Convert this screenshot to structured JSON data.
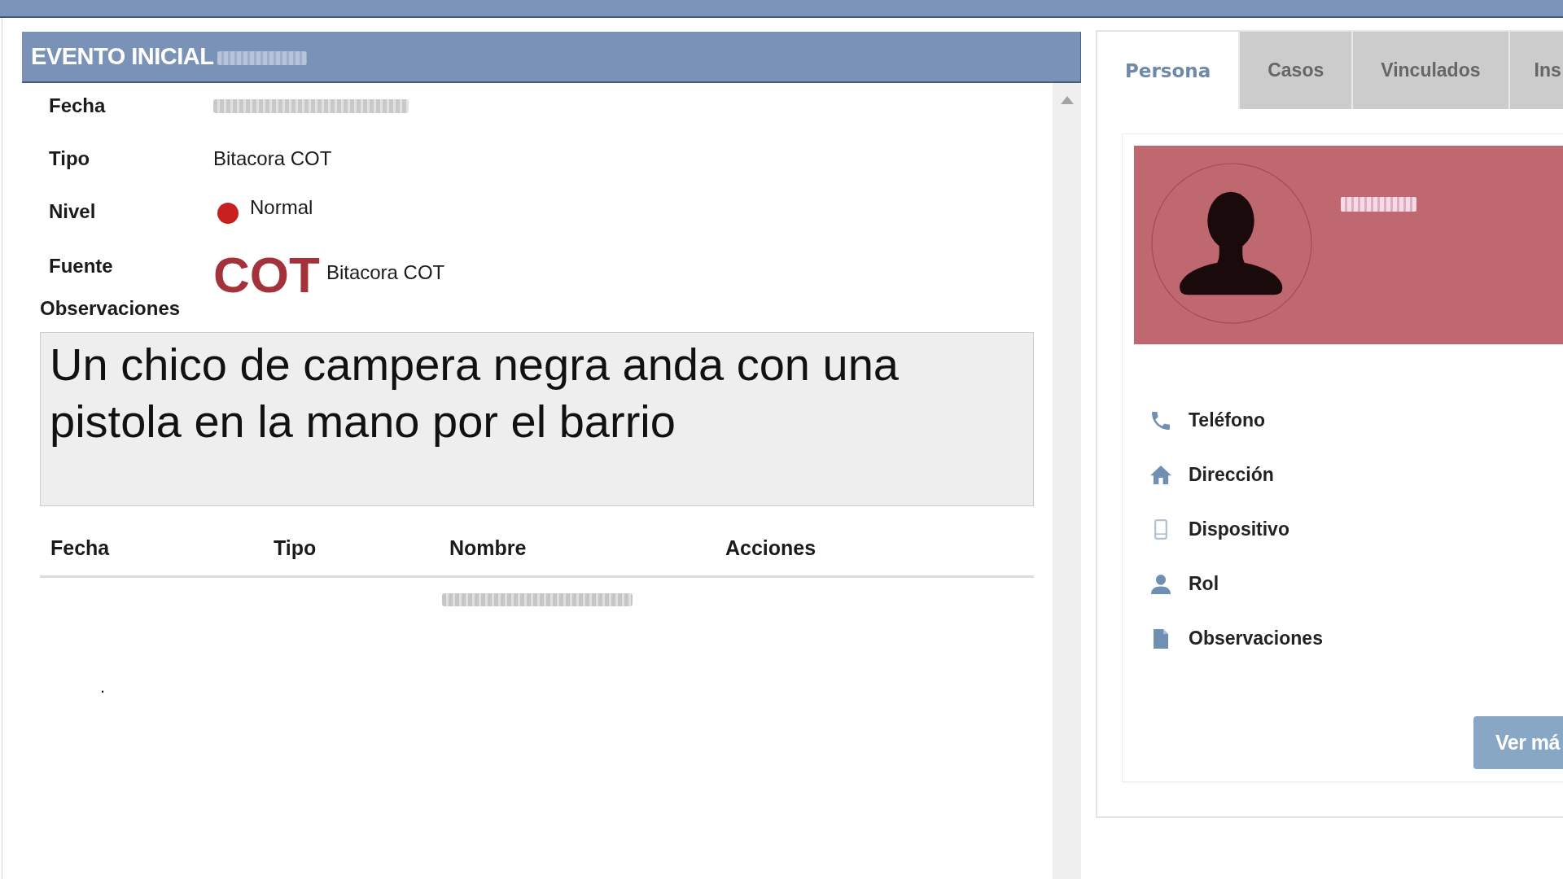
{
  "event": {
    "title": "EVENTO INICIAL",
    "title_redacted": true,
    "fields": [
      {
        "kind": "redacted",
        "label": "Fecha"
      },
      {
        "kind": "text",
        "label": "Tipo",
        "value": "Bitacora COT"
      },
      {
        "kind": "status",
        "label": "Nivel",
        "value": "Normal",
        "color": "#c8201f"
      },
      {
        "kind": "logo",
        "label": "Fuente",
        "logo": "COT",
        "value": "Bitacora COT"
      }
    ],
    "observations": {
      "label": "Observaciones",
      "value": "Un chico de campera negra anda con una pistola en la mano por el barrio"
    },
    "table": {
      "columns": [
        "Fecha",
        "Tipo",
        "Nombre",
        "Acciones"
      ],
      "empty_message_redacted": true,
      "mark": "."
    }
  },
  "person_panel": {
    "tabs": [
      {
        "label": "Persona",
        "selected": true
      },
      {
        "label": "Casos",
        "selected": false
      },
      {
        "label": "Vinculados",
        "selected": false
      },
      {
        "label": "Ins",
        "selected": false
      }
    ],
    "profile": {
      "name_redacted": true
    },
    "details": [
      {
        "kind": "phone",
        "label": "Teléfono"
      },
      {
        "kind": "home",
        "label": "Dirección"
      },
      {
        "kind": "device",
        "label": "Dispositivo"
      },
      {
        "kind": "user",
        "label": "Rol"
      },
      {
        "kind": "document",
        "label": "Observaciones"
      }
    ],
    "button": "Ver má"
  }
}
